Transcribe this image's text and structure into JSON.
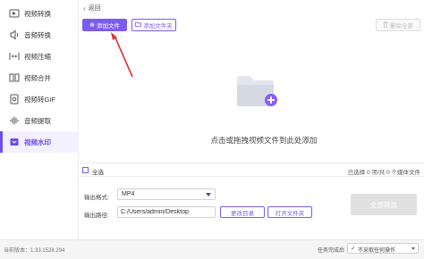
{
  "colors": {
    "accent": "#7c5cf0",
    "active_bg": "#f3f0ff",
    "disabled": "#e0e0e0"
  },
  "sidebar": {
    "items": [
      {
        "label": "视频转换",
        "icon": "video-convert-icon",
        "active": false
      },
      {
        "label": "音频转换",
        "icon": "audio-convert-icon",
        "active": false
      },
      {
        "label": "视频压缩",
        "icon": "video-compress-icon",
        "active": false
      },
      {
        "label": "视频合并",
        "icon": "video-merge-icon",
        "active": false
      },
      {
        "label": "视频转GIF",
        "icon": "video-to-gif-icon",
        "active": false
      },
      {
        "label": "音频提取",
        "icon": "audio-extract-icon",
        "active": false
      },
      {
        "label": "视频水印",
        "icon": "video-watermark-icon",
        "active": true
      }
    ]
  },
  "topbar": {
    "back_label": "返回"
  },
  "toolbar": {
    "add_file_label": "添加文件",
    "add_folder_label": "添加文件夹",
    "delete_all_label": "删除全部"
  },
  "dropzone": {
    "hint": "点击或拖拽视频文件到此处添加"
  },
  "selection": {
    "select_all_label": "全选",
    "count_text": "已选择 0 项/共 0 个媒体文件"
  },
  "output": {
    "format_label": "输出格式:",
    "format_value": "MP4",
    "path_label": "输出路径:",
    "path_value": "C:/Users/admin/Desktop",
    "change_dir_label": "更改目录",
    "open_folder_label": "打开文件夹",
    "convert_all_label": "全部转换"
  },
  "statusbar": {
    "version": "当前版本：1.33.1528.294",
    "after_label": "任务完成后",
    "after_value": "不采取任何操作"
  }
}
